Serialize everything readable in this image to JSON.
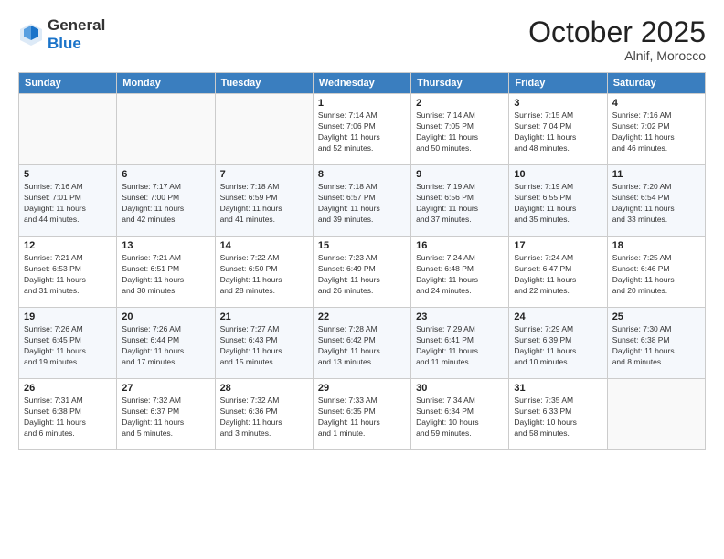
{
  "logo": {
    "general": "General",
    "blue": "Blue"
  },
  "header": {
    "month": "October 2025",
    "location": "Alnif, Morocco"
  },
  "weekdays": [
    "Sunday",
    "Monday",
    "Tuesday",
    "Wednesday",
    "Thursday",
    "Friday",
    "Saturday"
  ],
  "weeks": [
    [
      {
        "day": "",
        "info": ""
      },
      {
        "day": "",
        "info": ""
      },
      {
        "day": "",
        "info": ""
      },
      {
        "day": "1",
        "info": "Sunrise: 7:14 AM\nSunset: 7:06 PM\nDaylight: 11 hours\nand 52 minutes."
      },
      {
        "day": "2",
        "info": "Sunrise: 7:14 AM\nSunset: 7:05 PM\nDaylight: 11 hours\nand 50 minutes."
      },
      {
        "day": "3",
        "info": "Sunrise: 7:15 AM\nSunset: 7:04 PM\nDaylight: 11 hours\nand 48 minutes."
      },
      {
        "day": "4",
        "info": "Sunrise: 7:16 AM\nSunset: 7:02 PM\nDaylight: 11 hours\nand 46 minutes."
      }
    ],
    [
      {
        "day": "5",
        "info": "Sunrise: 7:16 AM\nSunset: 7:01 PM\nDaylight: 11 hours\nand 44 minutes."
      },
      {
        "day": "6",
        "info": "Sunrise: 7:17 AM\nSunset: 7:00 PM\nDaylight: 11 hours\nand 42 minutes."
      },
      {
        "day": "7",
        "info": "Sunrise: 7:18 AM\nSunset: 6:59 PM\nDaylight: 11 hours\nand 41 minutes."
      },
      {
        "day": "8",
        "info": "Sunrise: 7:18 AM\nSunset: 6:57 PM\nDaylight: 11 hours\nand 39 minutes."
      },
      {
        "day": "9",
        "info": "Sunrise: 7:19 AM\nSunset: 6:56 PM\nDaylight: 11 hours\nand 37 minutes."
      },
      {
        "day": "10",
        "info": "Sunrise: 7:19 AM\nSunset: 6:55 PM\nDaylight: 11 hours\nand 35 minutes."
      },
      {
        "day": "11",
        "info": "Sunrise: 7:20 AM\nSunset: 6:54 PM\nDaylight: 11 hours\nand 33 minutes."
      }
    ],
    [
      {
        "day": "12",
        "info": "Sunrise: 7:21 AM\nSunset: 6:53 PM\nDaylight: 11 hours\nand 31 minutes."
      },
      {
        "day": "13",
        "info": "Sunrise: 7:21 AM\nSunset: 6:51 PM\nDaylight: 11 hours\nand 30 minutes."
      },
      {
        "day": "14",
        "info": "Sunrise: 7:22 AM\nSunset: 6:50 PM\nDaylight: 11 hours\nand 28 minutes."
      },
      {
        "day": "15",
        "info": "Sunrise: 7:23 AM\nSunset: 6:49 PM\nDaylight: 11 hours\nand 26 minutes."
      },
      {
        "day": "16",
        "info": "Sunrise: 7:24 AM\nSunset: 6:48 PM\nDaylight: 11 hours\nand 24 minutes."
      },
      {
        "day": "17",
        "info": "Sunrise: 7:24 AM\nSunset: 6:47 PM\nDaylight: 11 hours\nand 22 minutes."
      },
      {
        "day": "18",
        "info": "Sunrise: 7:25 AM\nSunset: 6:46 PM\nDaylight: 11 hours\nand 20 minutes."
      }
    ],
    [
      {
        "day": "19",
        "info": "Sunrise: 7:26 AM\nSunset: 6:45 PM\nDaylight: 11 hours\nand 19 minutes."
      },
      {
        "day": "20",
        "info": "Sunrise: 7:26 AM\nSunset: 6:44 PM\nDaylight: 11 hours\nand 17 minutes."
      },
      {
        "day": "21",
        "info": "Sunrise: 7:27 AM\nSunset: 6:43 PM\nDaylight: 11 hours\nand 15 minutes."
      },
      {
        "day": "22",
        "info": "Sunrise: 7:28 AM\nSunset: 6:42 PM\nDaylight: 11 hours\nand 13 minutes."
      },
      {
        "day": "23",
        "info": "Sunrise: 7:29 AM\nSunset: 6:41 PM\nDaylight: 11 hours\nand 11 minutes."
      },
      {
        "day": "24",
        "info": "Sunrise: 7:29 AM\nSunset: 6:39 PM\nDaylight: 11 hours\nand 10 minutes."
      },
      {
        "day": "25",
        "info": "Sunrise: 7:30 AM\nSunset: 6:38 PM\nDaylight: 11 hours\nand 8 minutes."
      }
    ],
    [
      {
        "day": "26",
        "info": "Sunrise: 7:31 AM\nSunset: 6:38 PM\nDaylight: 11 hours\nand 6 minutes."
      },
      {
        "day": "27",
        "info": "Sunrise: 7:32 AM\nSunset: 6:37 PM\nDaylight: 11 hours\nand 5 minutes."
      },
      {
        "day": "28",
        "info": "Sunrise: 7:32 AM\nSunset: 6:36 PM\nDaylight: 11 hours\nand 3 minutes."
      },
      {
        "day": "29",
        "info": "Sunrise: 7:33 AM\nSunset: 6:35 PM\nDaylight: 11 hours\nand 1 minute."
      },
      {
        "day": "30",
        "info": "Sunrise: 7:34 AM\nSunset: 6:34 PM\nDaylight: 10 hours\nand 59 minutes."
      },
      {
        "day": "31",
        "info": "Sunrise: 7:35 AM\nSunset: 6:33 PM\nDaylight: 10 hours\nand 58 minutes."
      },
      {
        "day": "",
        "info": ""
      }
    ]
  ]
}
